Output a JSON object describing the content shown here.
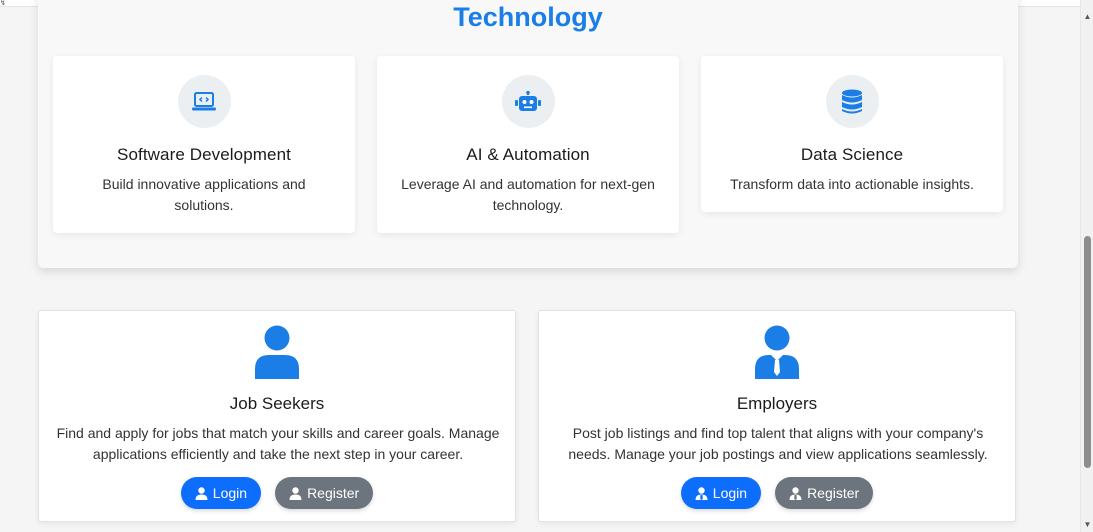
{
  "technology": {
    "title": "Technology",
    "cards": [
      {
        "icon": "laptop-code-icon",
        "title": "Software Development",
        "description": "Build innovative applications and solutions."
      },
      {
        "icon": "robot-icon",
        "title": "AI & Automation",
        "description": "Leverage AI and automation for next-gen technology."
      },
      {
        "icon": "database-icon",
        "title": "Data Science",
        "description": "Transform data into actionable insights."
      }
    ]
  },
  "roles": [
    {
      "icon": "user-icon",
      "title": "Job Seekers",
      "description": "Find and apply for jobs that match your skills and career goals. Manage applications efficiently and take the next step in your career.",
      "login_label": "Login",
      "register_label": "Register"
    },
    {
      "icon": "user-tie-icon",
      "title": "Employers",
      "description": "Post job listings and find top talent that aligns with your company's needs. Manage your job postings and view applications seamlessly.",
      "login_label": "Login",
      "register_label": "Register"
    }
  ],
  "colors": {
    "accent": "#1a7ee6",
    "primary_button": "#0d6efd",
    "secondary_button": "#6c757d"
  }
}
